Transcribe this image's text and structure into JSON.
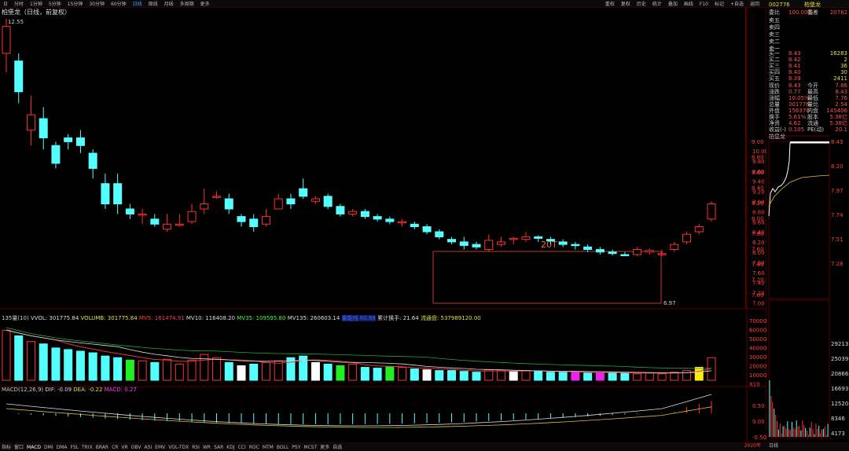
{
  "toolbar": {
    "left": [
      "日",
      "分时",
      "1分钟",
      "5分钟",
      "15分钟",
      "30分钟",
      "60分钟",
      "日线",
      "周线",
      "月线",
      "多周期",
      "更多"
    ],
    "right": [
      "重权",
      "复权",
      "历史",
      "统计",
      "叠加",
      "画线",
      "F10",
      "标记",
      "+自选",
      "返回"
    ]
  },
  "title": "柏堡龙（日线，前复权）",
  "price_axis": [
    "10.00",
    "9.80",
    "9.60",
    "9.40",
    "9.20",
    "9.00",
    "8.80",
    "8.60",
    "8.40",
    "8.20",
    "8.00",
    "7.80",
    "7.60",
    "7.40",
    "7.20",
    "7.00"
  ],
  "chart_labels": {
    "high": "12.55",
    "low": "6.97",
    "box": "20T"
  },
  "volume_info": {
    "name": "135量(10)",
    "vvol": "VVOL: 301775.84",
    "volumb": "VOLUMB: 301775.84",
    "mv5": "MV5: 161474.91",
    "mv10": "MV10: 116408.20",
    "mv35": "MV35: 109595.80",
    "mv135": "MV135: 260603.14",
    "mark": "量能线 60.88",
    "turnover": "累计换手: 21.64",
    "float": "流通盘: 537989120.00"
  },
  "volume_axis": [
    "70000",
    "60000",
    "50000",
    "40000",
    "30000",
    "20000",
    "10000",
    "X10"
  ],
  "macd_info": {
    "name": "MACD(12,26,9)",
    "dif": "DIF: -0.09",
    "dea": "DEA: -0.22",
    "macd": "MACD: 0.27"
  },
  "macd_axis": [
    "0.50",
    "0.00",
    "-0.50"
  ],
  "bottom_tabs": [
    "指标",
    "窗口",
    "MACD",
    "DMI",
    "DMA",
    "FSL",
    "TRIX",
    "BRAR",
    "CR",
    "VR",
    "OBV",
    "ASI",
    "EMV",
    "VOL-TDX",
    "RSI",
    "WR",
    "SAR",
    "KDJ",
    "CCI",
    "ROC",
    "MTM",
    "BOLL",
    "PSY",
    "MCST",
    "更多",
    "自选"
  ],
  "date_left": "2020年",
  "quote": {
    "code": "002776",
    "name": "柏堡龙",
    "weibi_label": "委比",
    "weibi_val": "100.00%",
    "weicha_label": "委差",
    "weicha_val": "20782",
    "sell_labels": [
      "卖五",
      "卖四",
      "卖三",
      "卖二",
      "卖一"
    ],
    "buy": [
      {
        "label": "买一",
        "price": "8.43",
        "vol": "16283"
      },
      {
        "label": "买二",
        "price": "8.42",
        "vol": "2"
      },
      {
        "label": "买三",
        "price": "8.41",
        "vol": "36"
      },
      {
        "label": "买四",
        "price": "8.40",
        "vol": "30"
      },
      {
        "label": "买五",
        "price": "8.39",
        "vol": "2411"
      }
    ],
    "stats": [
      {
        "l1": "现价",
        "v1": "8.43",
        "l2": "今开",
        "v2": "7.86"
      },
      {
        "l1": "涨跌",
        "v1": "0.77",
        "l2": "最高",
        "v2": "8.43"
      },
      {
        "l1": "涨幅",
        "v1": "10.05%",
        "l2": "最低",
        "v2": "7.76"
      },
      {
        "l1": "总量",
        "v1": "301776",
        "l2": "量比",
        "v2": "2.54"
      },
      {
        "l1": "外盘",
        "v1": "156370",
        "l2": "内盘",
        "v2": "145406"
      },
      {
        "l1": "换手",
        "v1": "5.61%",
        "l2": "股本",
        "v2": "5.38亿"
      },
      {
        "l1": "净资",
        "v1": "4.62",
        "l2": "流通",
        "v2": "5.38亿"
      },
      {
        "l1": "收益(-)",
        "v1": "0.105",
        "l2": "PE(动)",
        "v2": "20.1"
      }
    ],
    "mini_name": "柏堡龙",
    "mini_axis": [
      "8.43",
      "8.20",
      "7.97",
      "7.74",
      "7.51",
      "7.28"
    ],
    "mini_axis_left": [
      "9.00",
      "8.80",
      "8.60",
      "8.40",
      "8.20",
      "8.00",
      "7.80",
      "7.60",
      "7.40",
      "7.20",
      "7.00"
    ],
    "mini_vol": [
      "29213",
      "25039",
      "20866",
      "16693",
      "12520",
      "8346",
      "4173"
    ],
    "bottom_label": "日线"
  },
  "colors": {
    "up": "#ff3030",
    "down": "#54ffff",
    "box": "#c0392b",
    "text_red": "#ff4040"
  }
}
